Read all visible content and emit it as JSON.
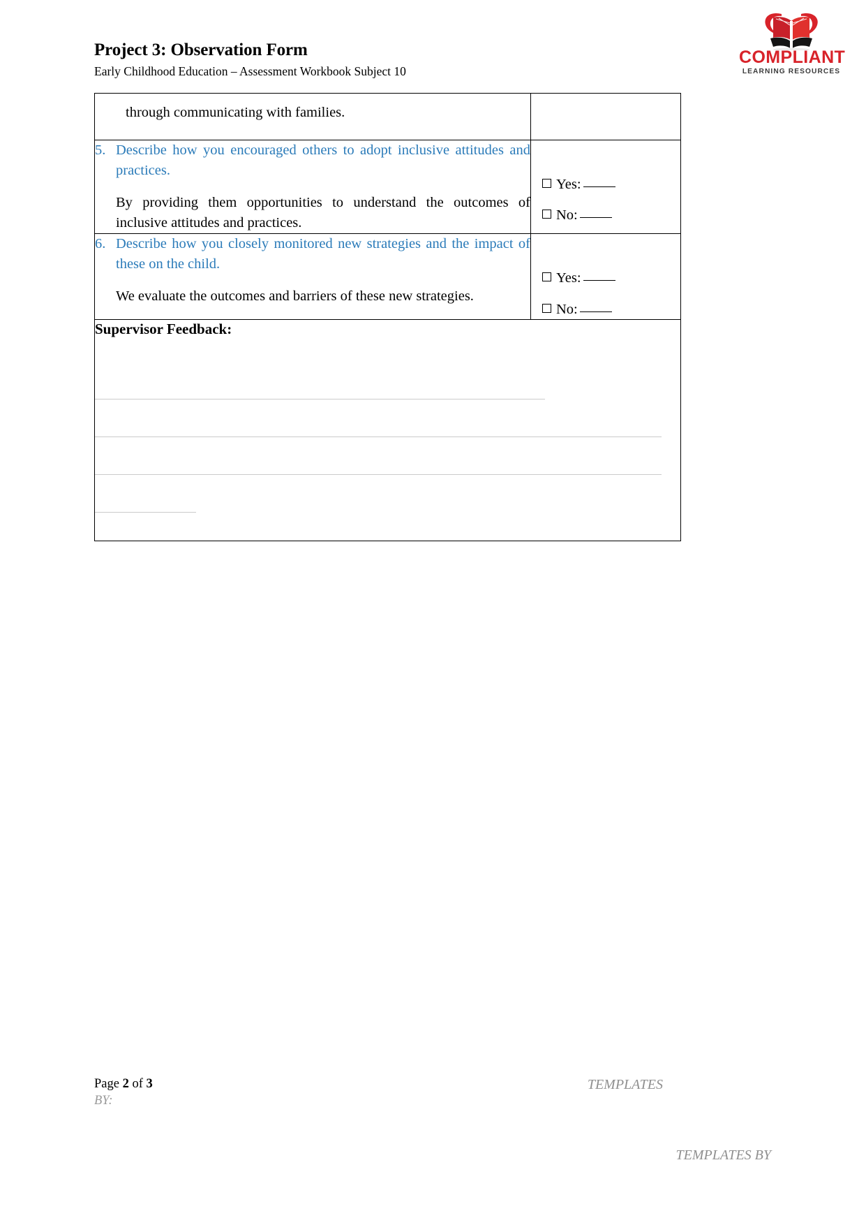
{
  "header": {
    "title": "Project 3: Observation Form",
    "subtitle": "Early Childhood Education – Assessment Workbook Subject 10"
  },
  "logo": {
    "icon": "open-book-logo",
    "wordmark": "COMPLIANT",
    "tagline": "LEARNING RESOURCES",
    "brand_red": "#D8232A",
    "brand_dark": "#1a1a1a"
  },
  "colors": {
    "question_blue": "#2B7BB9",
    "answer_black": "#000000",
    "rule_gray": "#cbcbcb",
    "footer_gray": "#8f8f8f"
  },
  "table": {
    "continuation_row": {
      "text": "through communicating with families."
    },
    "rows": [
      {
        "number": "5.",
        "question": "Describe how you encouraged others to adopt inclusive attitudes and practices.",
        "answer": "By providing them opportunities to understand the outcomes of inclusive attitudes and practices.",
        "checks": [
          {
            "label": "Yes:",
            "checked": false
          },
          {
            "label": "No:",
            "checked": false
          }
        ]
      },
      {
        "number": "6.",
        "question": "Describe how you closely monitored new strategies and the impact of these on the child.",
        "answer": "We evaluate the outcomes and barriers of these new strategies.",
        "checks": [
          {
            "label": "Yes:",
            "checked": false
          },
          {
            "label": "No:",
            "checked": false
          }
        ]
      }
    ],
    "feedback": {
      "title": "Supervisor Feedback:",
      "value": "",
      "line_count": 4
    }
  },
  "footer": {
    "page_label": "Page",
    "page_current": "2",
    "page_of": "of",
    "page_total": "3",
    "by_label": "BY:",
    "templates_label": "TEMPLATES",
    "templates_by_label": "TEMPLATES BY"
  }
}
